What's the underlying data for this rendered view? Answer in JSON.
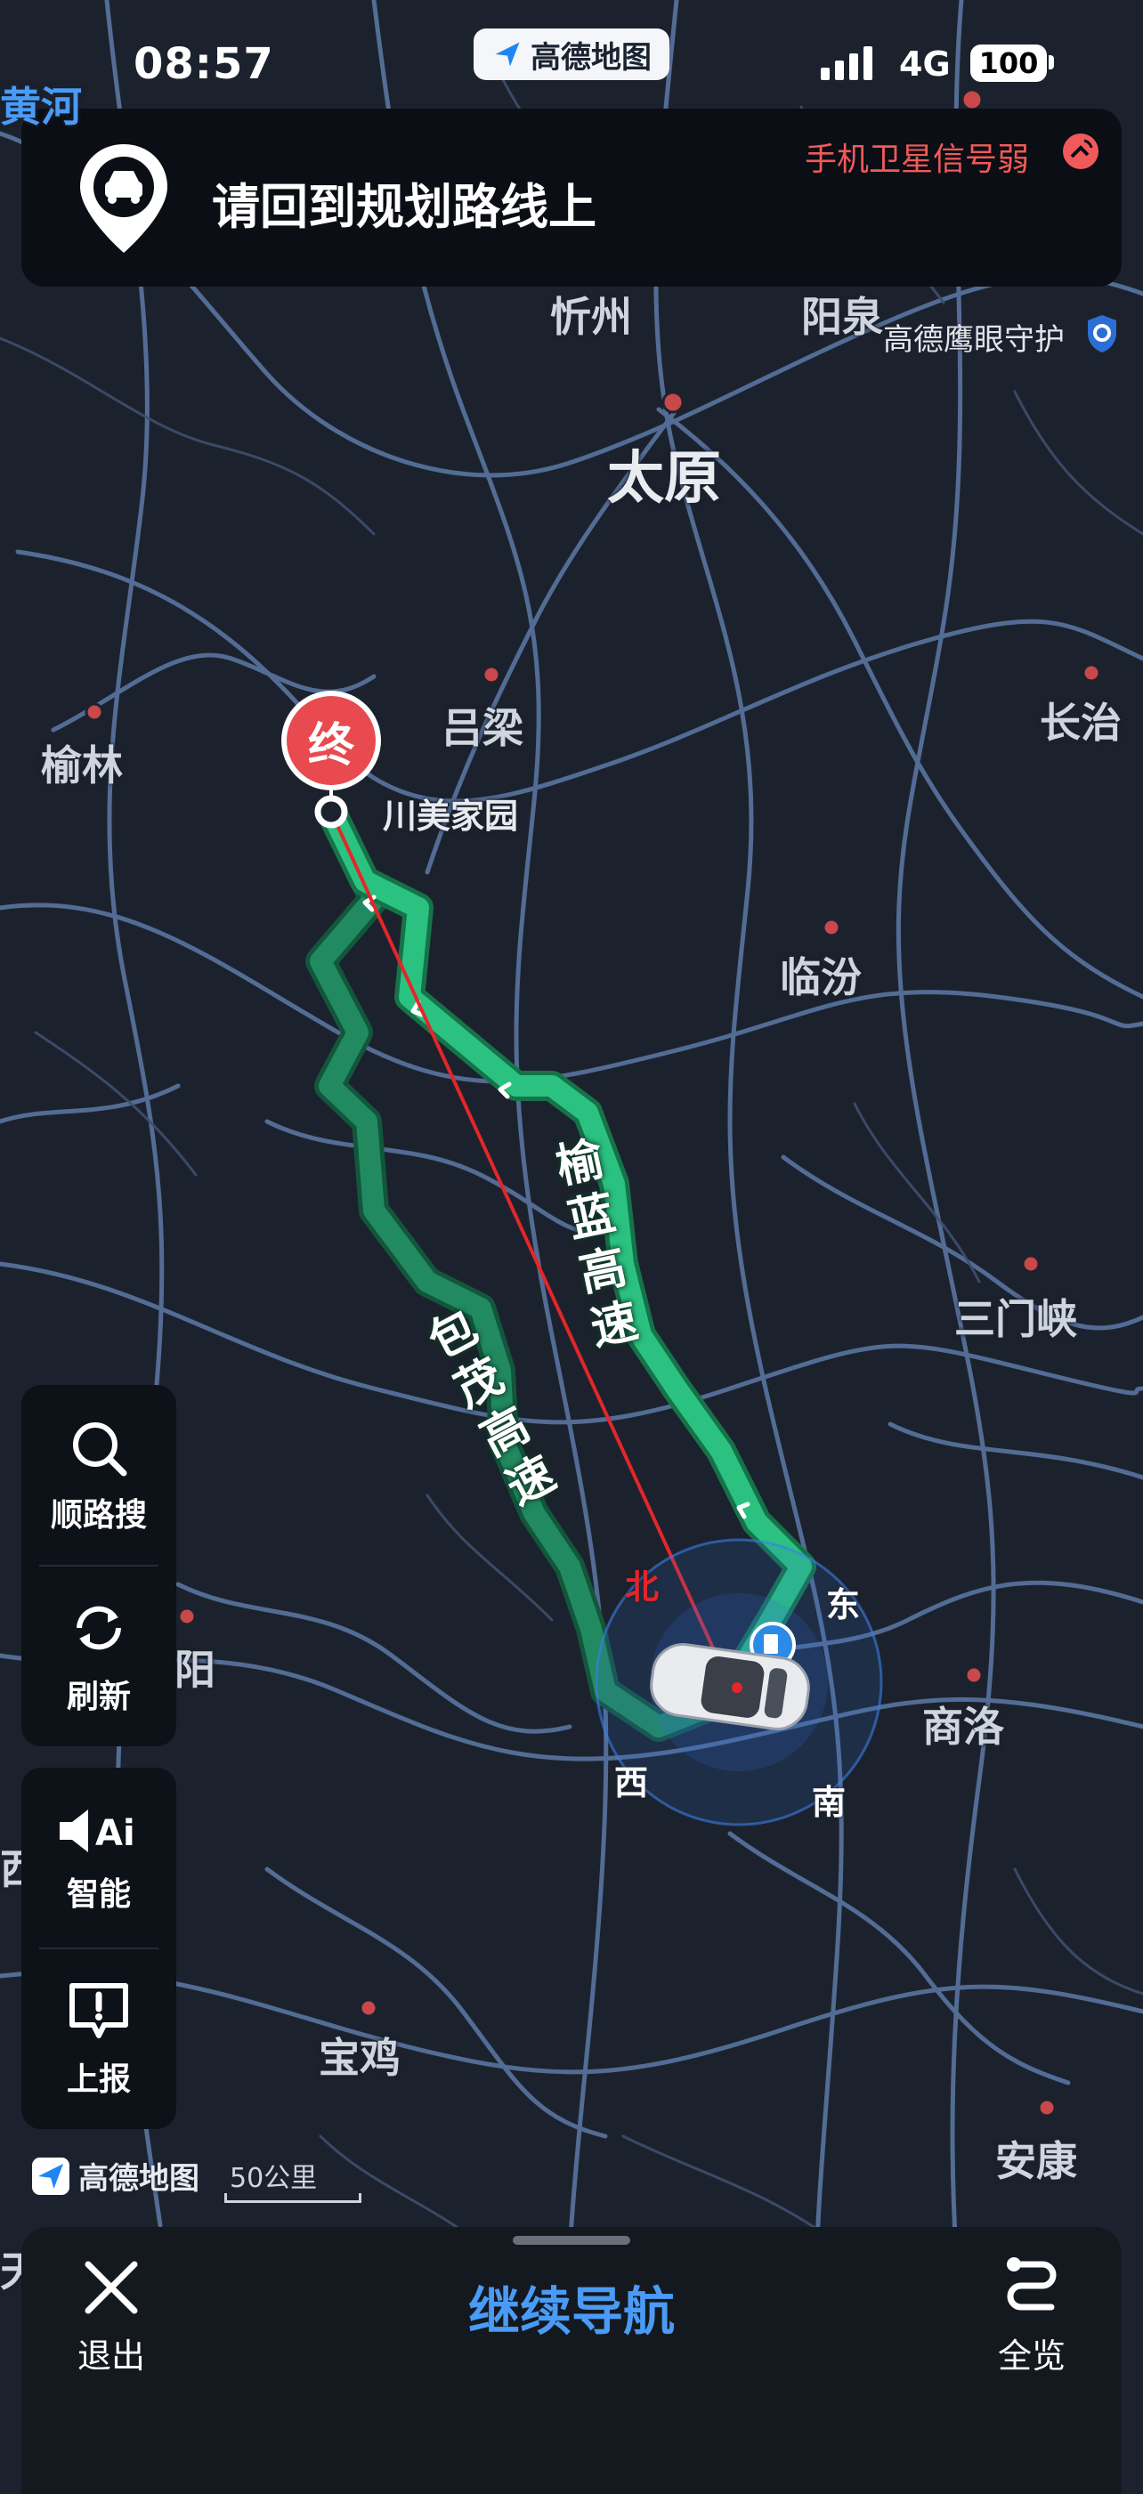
{
  "status_bar": {
    "time": "08:57",
    "app_badge": "高德地图",
    "network": "4G",
    "battery": "100"
  },
  "banner": {
    "message": "请回到规划路线上",
    "satellite_warning": "手机卫星信号弱"
  },
  "map": {
    "labels": {
      "xinzhou": "忻州",
      "yangquan": "阳泉",
      "taiyuan": "太原",
      "luliang": "吕梁",
      "yulin": "榆林",
      "changzhi": "长治",
      "linfen": "临汾",
      "sanmenxia": "三门峡",
      "shangluo": "商洛",
      "baoji": "宝鸡",
      "ankang": "安康",
      "huanghe": "黄河",
      "edge_yang": "阳",
      "edge_xi": "西",
      "edge_tian": "天"
    },
    "eagle_eye": "高德鹰眼守护",
    "destination_badge": "终",
    "destination_name": "川美家园",
    "roads": {
      "yulan": "榆蓝高速",
      "baomao": "包茂高速"
    },
    "compass": {
      "north": "北",
      "east": "东",
      "south": "南",
      "west": "西"
    },
    "scale": "50公里",
    "logo": "高德地图"
  },
  "side_panel": {
    "search_label": "顺路搜",
    "refresh_label": "刷新",
    "smart_label": "智能",
    "report_label": "上报"
  },
  "bottom": {
    "exit_label": "退出",
    "continue_label": "继续导航",
    "overview_label": "全览"
  },
  "colors": {
    "map_bg": "#1c222d",
    "road": "#5f7fb0",
    "route_green": "#2bc281",
    "route_dark": "#1f8a5e",
    "warning_red": "#f05a5a",
    "accent_blue": "#4a9bf5"
  }
}
